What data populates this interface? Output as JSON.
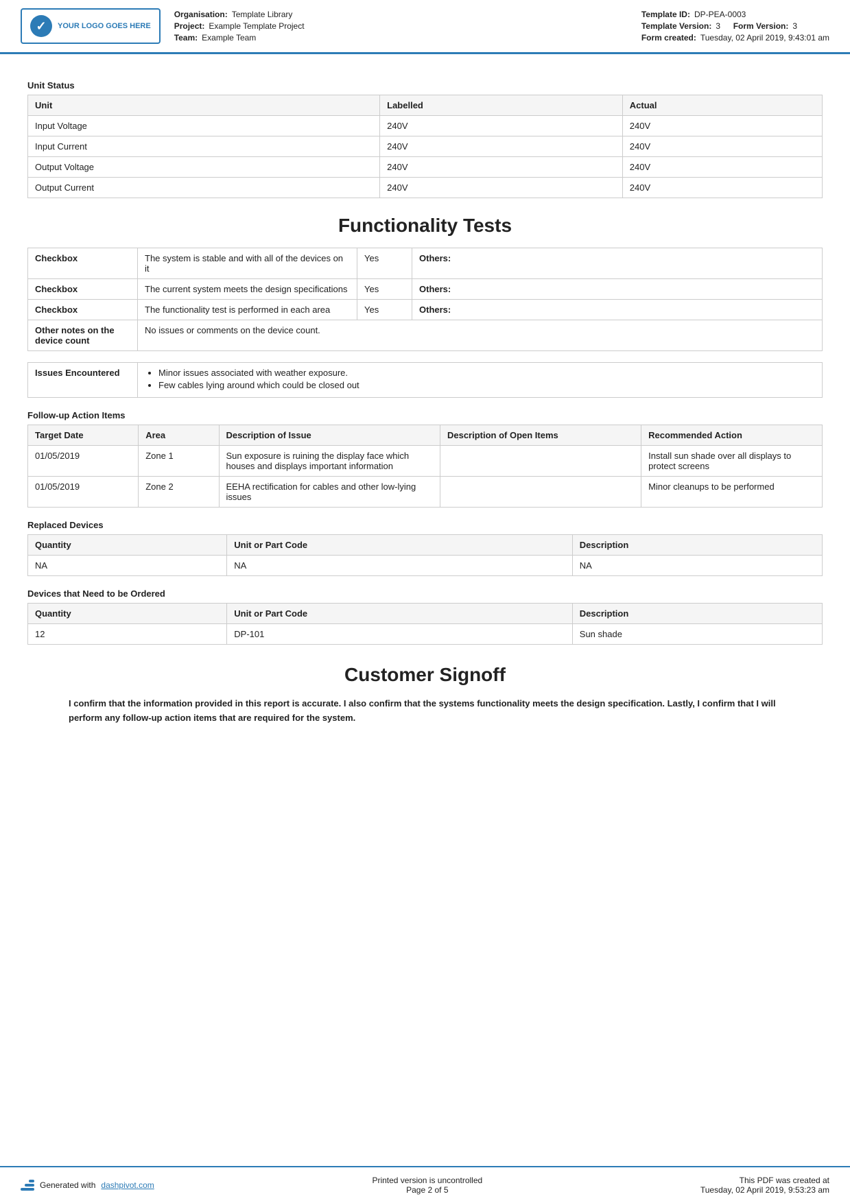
{
  "header": {
    "logo_text": "YOUR LOGO GOES HERE",
    "org_label": "Organisation:",
    "org_value": "Template Library",
    "project_label": "Project:",
    "project_value": "Example Template Project",
    "team_label": "Team:",
    "team_value": "Example Team",
    "template_id_label": "Template ID:",
    "template_id_value": "DP-PEA-0003",
    "template_version_label": "Template Version:",
    "template_version_value": "3",
    "form_version_label": "Form Version:",
    "form_version_value": "3",
    "form_created_label": "Form created:",
    "form_created_value": "Tuesday, 02 April 2019, 9:43:01 am"
  },
  "unit_status": {
    "title": "Unit Status",
    "columns": [
      "Unit",
      "Labelled",
      "Actual"
    ],
    "rows": [
      [
        "Input Voltage",
        "240V",
        "240V"
      ],
      [
        "Input Current",
        "240V",
        "240V"
      ],
      [
        "Output Voltage",
        "240V",
        "240V"
      ],
      [
        "Output Current",
        "240V",
        "240V"
      ]
    ]
  },
  "functionality_tests": {
    "heading": "Functionality Tests",
    "rows": [
      {
        "label": "Checkbox",
        "description": "The system is stable and with all of the devices on it",
        "value": "Yes",
        "others_label": "Others:"
      },
      {
        "label": "Checkbox",
        "description": "The current system meets the design specifications",
        "value": "Yes",
        "others_label": "Others:"
      },
      {
        "label": "Checkbox",
        "description": "The functionality test is performed in each area",
        "value": "Yes",
        "others_label": "Others:"
      },
      {
        "label": "Other notes on the device count",
        "description": "No issues or comments on the device count.",
        "value": "",
        "others_label": ""
      }
    ],
    "issues_label": "Issues Encountered",
    "issues": [
      "Minor issues associated with weather exposure.",
      "Few cables lying around which could be closed out"
    ]
  },
  "followup": {
    "title": "Follow-up Action Items",
    "columns": [
      "Target Date",
      "Area",
      "Description of Issue",
      "Description of Open Items",
      "Recommended Action"
    ],
    "rows": [
      {
        "target_date": "01/05/2019",
        "area": "Zone 1",
        "description": "Sun exposure is ruining the display face which houses and displays important information",
        "open_items": "",
        "recommended": "Install sun shade over all displays to protect screens"
      },
      {
        "target_date": "01/05/2019",
        "area": "Zone 2",
        "description": "EEHA rectification for cables and other low-lying issues",
        "open_items": "",
        "recommended": "Minor cleanups to be performed"
      }
    ]
  },
  "replaced_devices": {
    "title": "Replaced Devices",
    "columns": [
      "Quantity",
      "Unit or Part Code",
      "Description"
    ],
    "rows": [
      [
        "NA",
        "NA",
        "NA"
      ]
    ]
  },
  "devices_to_order": {
    "title": "Devices that Need to be Ordered",
    "columns": [
      "Quantity",
      "Unit or Part Code",
      "Description"
    ],
    "rows": [
      [
        "12",
        "DP-101",
        "Sun shade"
      ]
    ]
  },
  "customer_signoff": {
    "heading": "Customer Signoff",
    "text": "I confirm that the information provided in this report is accurate. I also confirm that the systems functionality meets the design specification. Lastly, I confirm that I will perform any follow-up action items that are required for the system."
  },
  "footer": {
    "generated_text": "Generated with",
    "link_text": "dashpivot.com",
    "uncontrolled_text": "Printed version is uncontrolled",
    "page_text": "Page 2 of 5",
    "pdf_created_text": "This PDF was created at",
    "pdf_created_date": "Tuesday, 02 April 2019, 9:53:23 am"
  }
}
